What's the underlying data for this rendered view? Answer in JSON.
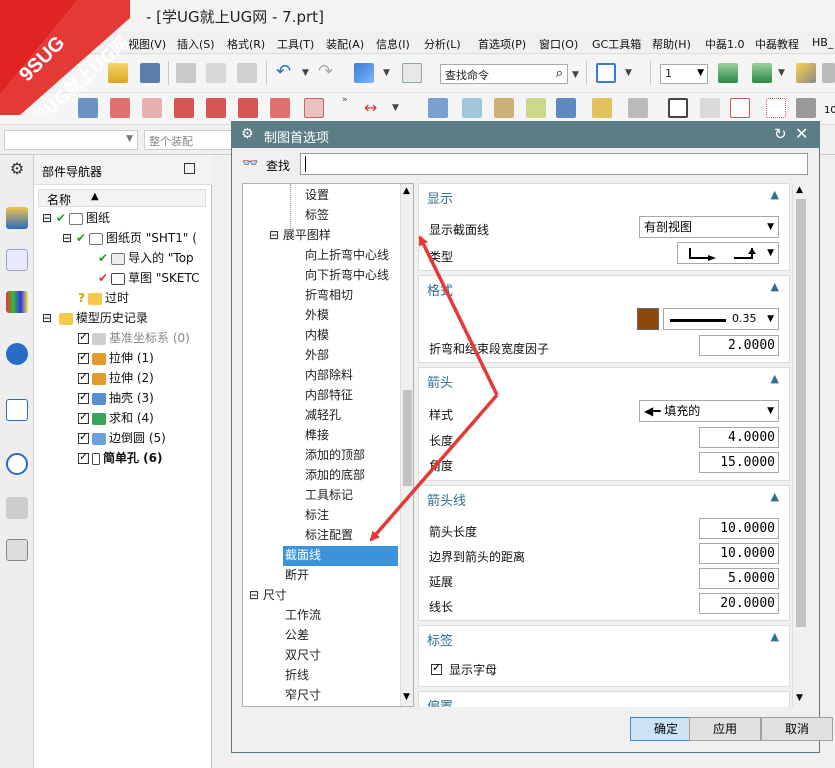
{
  "window": {
    "title": "- [学UG就上UG网 - 7.prt]"
  },
  "logo": {
    "text1": "9SUG",
    "text2": "学UG就上UG网"
  },
  "menu": [
    "视图(V)",
    "插入(S)",
    "格式(R)",
    "工具(T)",
    "装配(A)",
    "信息(I)",
    "分析(L)",
    "首选项(P)",
    "窗口(O)",
    "GC工具箱",
    "帮助(H)",
    "中磊1.0",
    "中磊教程",
    "HB_"
  ],
  "toolbar": {
    "search_placeholder": "查找命令",
    "layer_value": "1",
    "assembly_placeholder": "整个装配"
  },
  "navigator": {
    "title": "部件导航器",
    "col_name": "名称",
    "items": [
      {
        "label": "图纸"
      },
      {
        "label": "图纸页 \"SHT1\" ("
      },
      {
        "label": "导入的 \"Top"
      },
      {
        "label": "草图 \"SKETC"
      },
      {
        "label": "过时"
      },
      {
        "label": "模型历史记录"
      },
      {
        "label": "基准坐标系 (0)"
      },
      {
        "label": "拉伸 (1)"
      },
      {
        "label": "拉伸 (2)"
      },
      {
        "label": "抽壳 (3)"
      },
      {
        "label": "求和 (4)"
      },
      {
        "label": "边倒圆 (5)"
      },
      {
        "label": "简单孔 (6)"
      }
    ]
  },
  "dialog": {
    "title": "制图首选项",
    "find_label": "查找",
    "tree": [
      "设置",
      "标签",
      "展平图样",
      "向上折弯中心线",
      "向下折弯中心线",
      "折弯相切",
      "外模",
      "内模",
      "外部",
      "内部除料",
      "内部特征",
      "减轻孔",
      "榫接",
      "添加的顶部",
      "添加的底部",
      "工具标记",
      "标注",
      "标注配置",
      "截面线",
      "断开",
      "尺寸",
      "工作流",
      "公差",
      "双尺寸",
      "折线",
      "窄尺寸"
    ],
    "groups": {
      "display": {
        "title": "显示",
        "show_section_label": "显示截面线",
        "show_section_value": "有剖视图",
        "type_label": "类型"
      },
      "format": {
        "title": "格式",
        "color": "#8b4a0c",
        "width_value": "0.35 mm",
        "bend_factor_label": "折弯和结束段宽度因子",
        "bend_factor_value": "2.0000"
      },
      "arrow": {
        "title": "箭头",
        "style_label": "样式",
        "style_value": "填充的",
        "length_label": "长度",
        "length_value": "4.0000",
        "angle_label": "角度",
        "angle_value": "15.0000"
      },
      "arrow_line": {
        "title": "箭头线",
        "arrow_length_label": "箭头长度",
        "arrow_length_value": "10.0000",
        "border_dist_label": "边界到箭头的距离",
        "border_dist_value": "10.0000",
        "extend_label": "延展",
        "extend_value": "5.0000",
        "line_length_label": "线长",
        "line_length_value": "20.0000"
      },
      "label": {
        "title": "标签",
        "show_letter_label": "显示字母"
      },
      "position": {
        "title": "偏置"
      }
    },
    "buttons": {
      "ok": "确定",
      "apply": "应用",
      "cancel": "取消"
    }
  },
  "colors": {
    "dialog_title_bg": "#5c7d86",
    "selection": "#3c93d9",
    "annotation_arrow": "#e53935"
  }
}
